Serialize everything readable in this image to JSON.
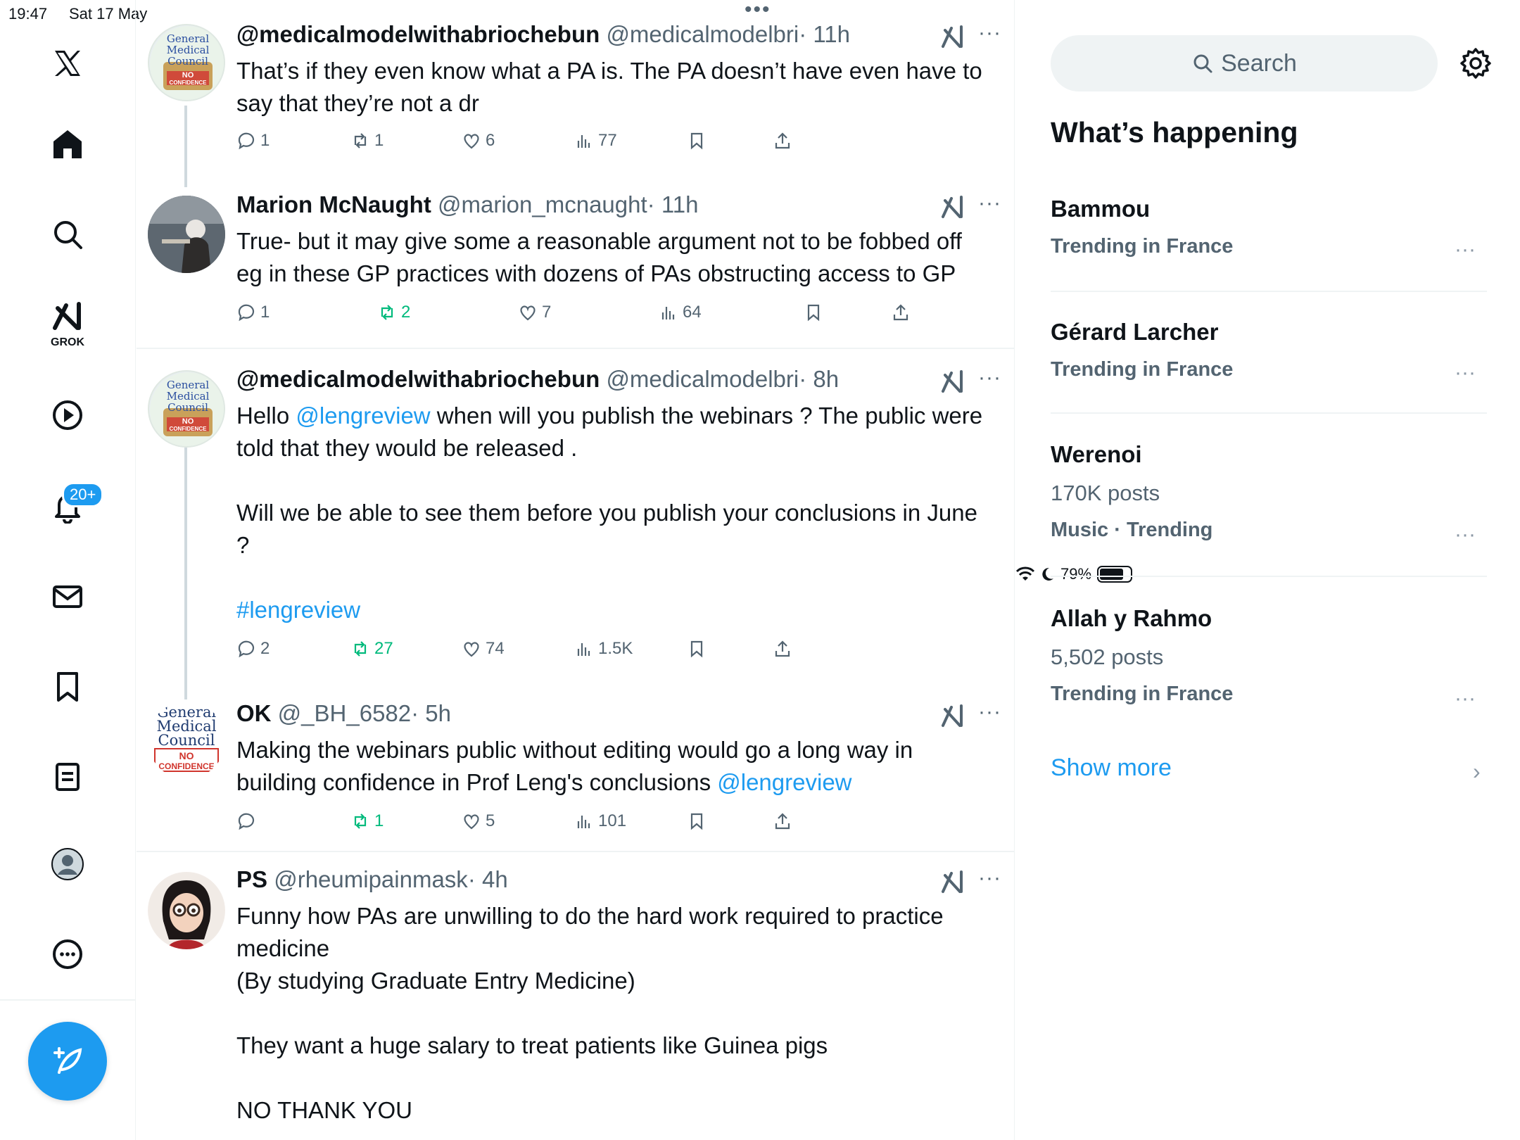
{
  "status": {
    "time": "19:47",
    "date": "Sat 17 May",
    "battery": "79%",
    "battery_level": 0.79
  },
  "nav": {
    "grok_label": "GROK",
    "notifications_badge": "20+"
  },
  "tweets": [
    {
      "name": "@medicalmodelwithabriochebun",
      "handle": "@medicalmodelbri",
      "time": "· 11h",
      "body": "That’s if they even know what a PA is. The PA doesn’t have even have to say that they’re not a dr",
      "replies": "1",
      "reposts": "1",
      "likes": "6",
      "views": "77"
    },
    {
      "name": "Marion McNaught",
      "handle": "@marion_mcnaught",
      "time": "· 11h",
      "body": "True- but it may give some a reasonable argument not to be fobbed off eg in these GP practices with dozens of PAs obstructing access to GP",
      "replies": "1",
      "reposts": "2",
      "likes": "7",
      "views": "64"
    },
    {
      "name": "@medicalmodelwithabriochebun",
      "handle": "@medicalmodelbri",
      "time": "· 8h",
      "body_pre": "Hello ",
      "mention": "@lengreview",
      "body_post": " when will you publish the webinars ? The public were told that they would be released .\n\nWill we be able to see them before you publish your conclusions in June ?\n\n",
      "hashtag": "#lengreview",
      "replies": "2",
      "reposts": "27",
      "likes": "74",
      "views": "1.5K"
    },
    {
      "name": "OK",
      "handle": "@_BH_6582",
      "time": "· 5h",
      "body_pre": "Making the webinars public without editing would go a long way in building confidence in Prof Leng's conclusions ",
      "mention": "@lengreview",
      "replies": "",
      "reposts": "1",
      "likes": "5",
      "views": "101"
    },
    {
      "name": "PS",
      "handle": "@rheumipainmask",
      "time": "· 4h",
      "body": "Funny how PAs are unwilling to do the hard work required to practice medicine\n(By studying Graduate Entry Medicine)\n\nThey want a huge salary to treat patients like Guinea pigs\n\nNO THANK YOU"
    }
  ],
  "avatar_text": {
    "gmc_1": "General",
    "gmc_2": "Medical",
    "gmc_3": "Council",
    "gmc_4": "NO",
    "gmc_5": "CONFIDENCE"
  },
  "sidebar": {
    "search_placeholder": "Search",
    "title": "What’s happening",
    "trends": [
      {
        "name": "Bammou",
        "posts": "",
        "meta": "Trending in France"
      },
      {
        "name": "Gérard Larcher",
        "posts": "",
        "meta": "Trending in France"
      },
      {
        "name": "Werenoi",
        "posts": "170K posts",
        "meta": "Music · Trending"
      },
      {
        "name": "Allah y Rahmo",
        "posts": "5,502 posts",
        "meta": "Trending in France"
      }
    ],
    "show_more": "Show more"
  },
  "colors": {
    "accent": "#1d9bf0",
    "repost_green": "#00ba7c",
    "muted": "#536471"
  }
}
